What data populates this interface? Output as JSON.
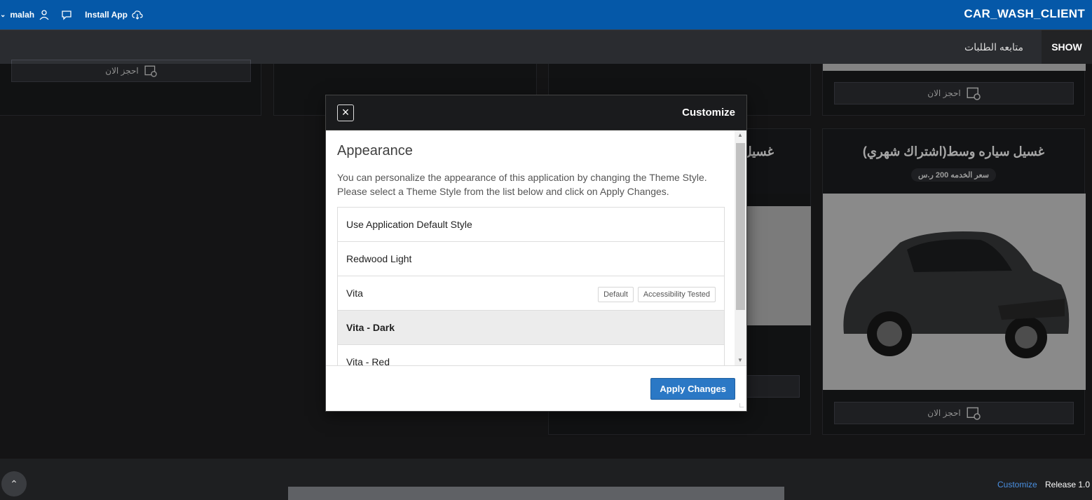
{
  "topbar": {
    "user": "malah",
    "install": "Install App",
    "title": "CAR_WASH_CLIENT"
  },
  "menu": {
    "show": "SHOW",
    "track": "متابعه الطلبات"
  },
  "cards": {
    "book_label": "احجز الان",
    "main_title": "غسيل سياره وسط(اشتراك شهري)",
    "price": "سعر الخدمه 200 ر.س",
    "second_title_fragment": "غسيل"
  },
  "dialog": {
    "title": "Customize",
    "heading": "Appearance",
    "description": "You can personalize the appearance of this application by changing the Theme Style. Please select a Theme Style from the list below and click on Apply Changes.",
    "options": [
      {
        "label": "Use Application Default Style"
      },
      {
        "label": "Redwood Light"
      },
      {
        "label": "Vita",
        "tags": [
          "Default",
          "Accessibility Tested"
        ]
      },
      {
        "label": "Vita - Dark",
        "selected": true
      },
      {
        "label": "Vita - Red"
      }
    ],
    "apply": "Apply Changes"
  },
  "footer": {
    "customize": "Customize",
    "release": "Release 1.0"
  }
}
